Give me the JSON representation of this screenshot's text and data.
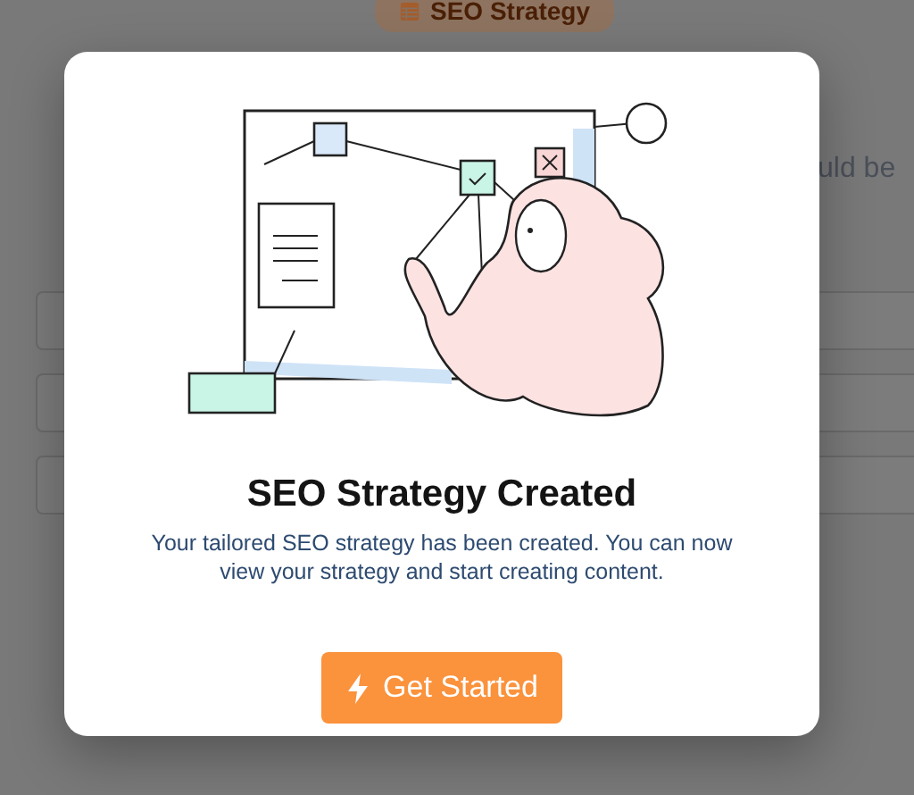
{
  "background": {
    "tab_label": "SEO Strategy",
    "partial_text": "uld be"
  },
  "modal": {
    "title": "SEO Strategy Created",
    "description": "Your tailored SEO strategy has been created. You can now view your strategy and start creating content.",
    "button": "Get Started"
  }
}
